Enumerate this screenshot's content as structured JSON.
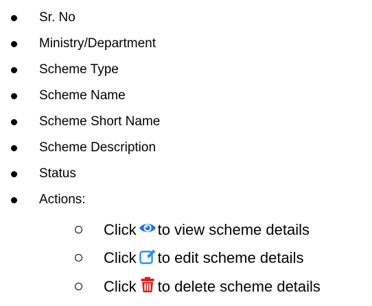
{
  "items": [
    {
      "label": "Sr. No"
    },
    {
      "label": "Ministry/Department"
    },
    {
      "label": "Scheme Type"
    },
    {
      "label": "Scheme Name"
    },
    {
      "label": "Scheme Short Name"
    },
    {
      "label": "Scheme Description"
    },
    {
      "label": "Status"
    },
    {
      "label": "Actions:"
    }
  ],
  "actions": [
    {
      "prefix": "Click",
      "icon": "eye-icon",
      "suffix": "to view scheme details",
      "color": "#1e73e8"
    },
    {
      "prefix": "Click",
      "icon": "edit-icon",
      "suffix": "to edit scheme details",
      "color": "#2b8ff0"
    },
    {
      "prefix": "Click",
      "icon": "trash-icon",
      "suffix": "to delete scheme details",
      "color": "#e02020"
    }
  ]
}
